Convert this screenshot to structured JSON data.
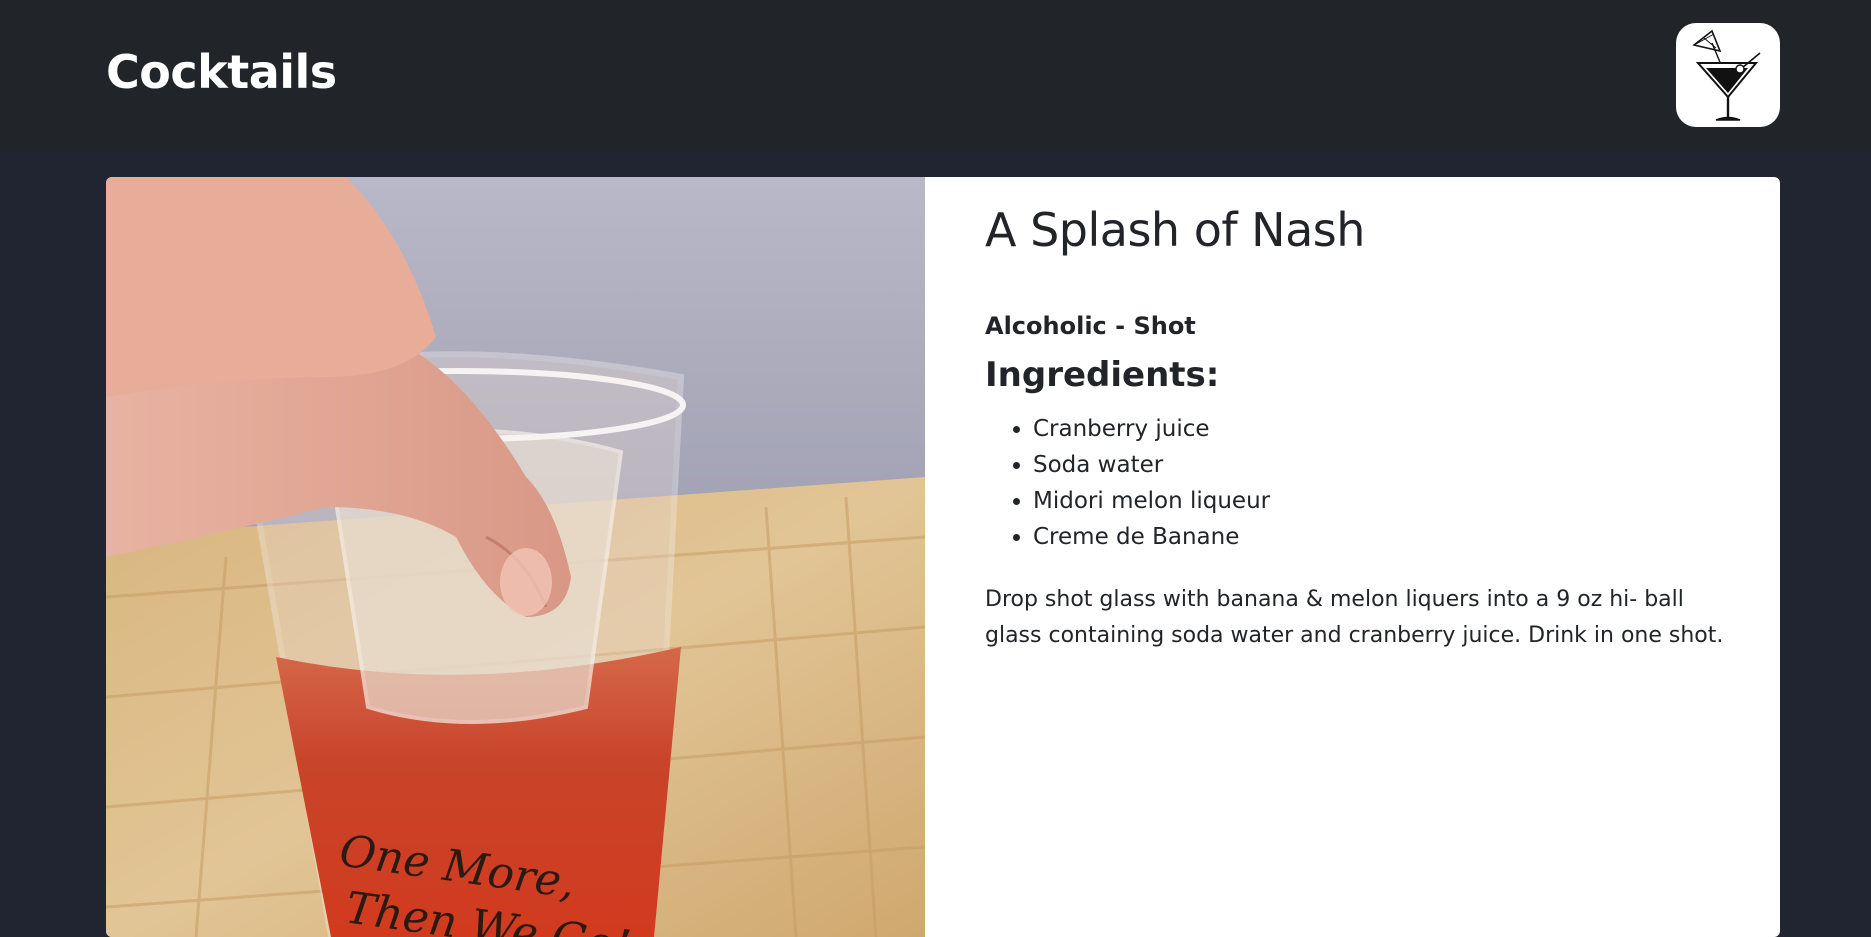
{
  "app": {
    "brand": "Cocktails",
    "logo_icon": "martini-glass-icon"
  },
  "drink": {
    "title": "A Splash of Nash",
    "category": "Alcoholic - Shot",
    "ingredients_heading": "Ingredients:",
    "ingredients": [
      "Cranberry juice",
      "Soda water",
      "Midori melon liqueur",
      "Creme de Banane"
    ],
    "instructions": "Drop shot glass with banana & melon liquers into a 9 oz hi- ball glass containing soda water and cranberry juice. Drink in one shot.",
    "photo_glass_text": [
      "One More,",
      "Then We Go!"
    ]
  },
  "colors": {
    "page_background": "#212431",
    "navbar_background": "#212529",
    "card_background": "#ffffff",
    "text": "#212529"
  }
}
